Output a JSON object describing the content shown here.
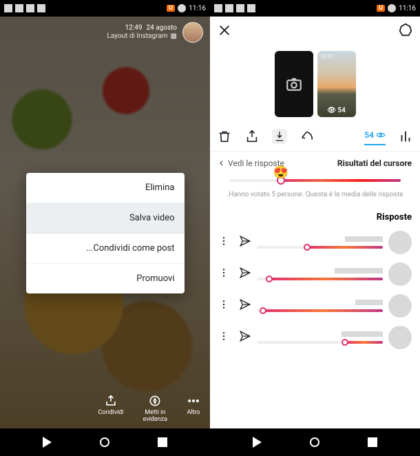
{
  "status": {
    "time": "11:16"
  },
  "left": {
    "story": {
      "date": "24 agosto",
      "time": "12:49",
      "layout_label": "Layout di Instagram"
    },
    "menu": {
      "elimina": "Elimina",
      "salva_video": "Salva video",
      "condividi_post": "Condividi come post...",
      "promuovi": "Promuovi"
    },
    "footer": {
      "altro": "Altro",
      "metti": "Metti in\nevidenza",
      "condividi": "Condividi"
    }
  },
  "right": {
    "thumb_views": "54",
    "views_link": "54",
    "section": {
      "results_title": "Risultati del cursore",
      "replies_link": "Vedi le risposte"
    },
    "slider": {
      "emoji": "😍",
      "percent": 70
    },
    "caption": "Hanno votato 5 persone. Questa é la media delle risposte.",
    "risposte_title": "Risposte",
    "replies": [
      {
        "percent": 60,
        "name_w": 55
      },
      {
        "percent": 90,
        "name_w": 70
      },
      {
        "percent": 95,
        "name_w": 40
      },
      {
        "percent": 30,
        "name_w": 60
      }
    ]
  }
}
